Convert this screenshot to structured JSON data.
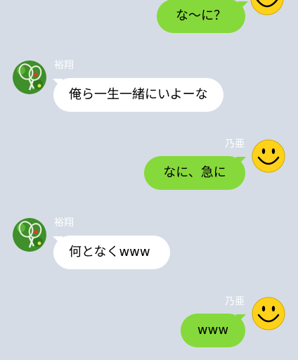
{
  "colors": {
    "background": "#d5dce6",
    "my_bubble": "#86d93a",
    "their_bubble": "#ffffff",
    "name_text": "#ffffff",
    "smiley": "#ffd21a"
  },
  "messages": [
    {
      "sender": "",
      "side": "me",
      "text": "な〜に？",
      "avatar": "smiley-icon"
    },
    {
      "sender": "裕翔",
      "side": "them",
      "text": "俺ら一生一緒にいよーな",
      "avatar": "tennis-racket-icon"
    },
    {
      "sender": "乃亜",
      "side": "me",
      "text": "なに、急に",
      "avatar": "smiley-icon"
    },
    {
      "sender": "裕翔",
      "side": "them",
      "text": "何となくwww",
      "avatar": "tennis-racket-icon"
    },
    {
      "sender": "乃亜",
      "side": "me",
      "text": "www",
      "avatar": "smiley-icon"
    }
  ]
}
